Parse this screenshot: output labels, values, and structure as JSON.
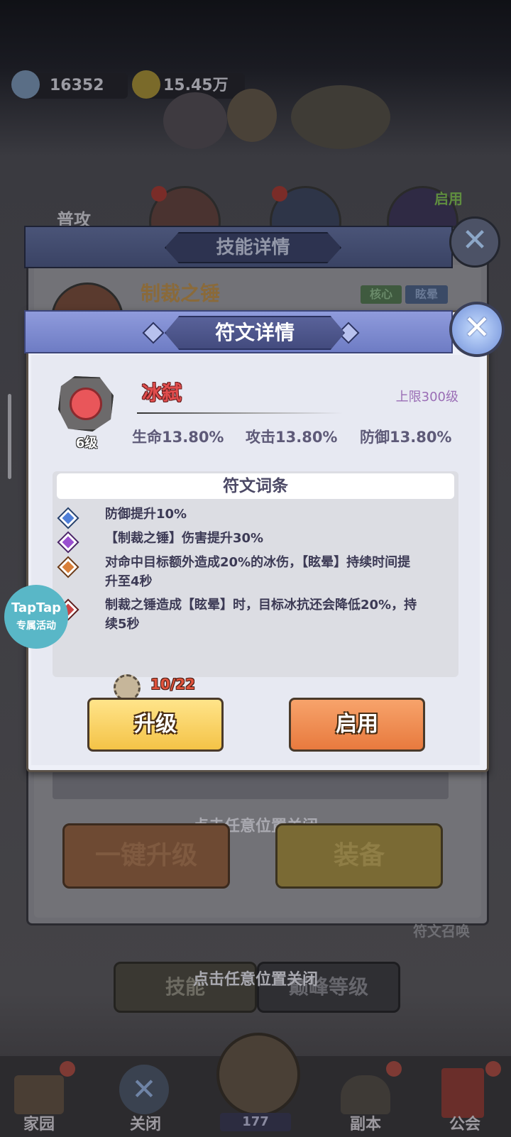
{
  "resources": {
    "gems": "16352",
    "gold": "15.45万"
  },
  "background": {
    "skill_tab_partial": "普攻",
    "enable_tag": "启用",
    "skill_name": "制裁之锤",
    "skill_tags": [
      "核心",
      "眩晕"
    ],
    "btn_upgrade_all": "一键升级",
    "btn_equip": "装备",
    "rune_summon": "符文召唤",
    "tab_skill": "技能",
    "tab_peak": "巅峰等级",
    "close_hint": "点击任意位置关闭"
  },
  "skill_panel": {
    "title": "技能详情"
  },
  "rune_panel": {
    "title": "符文详情",
    "rune_name": "冰弑",
    "level": "6级",
    "max_level": "上限300级",
    "stats": [
      "生命13.80%",
      "攻击13.80%",
      "防御13.80%"
    ],
    "entries_title": "符文词条",
    "entries": [
      {
        "text": "防御提升10%",
        "color": "#4f7fd8"
      },
      {
        "text": "【制裁之锤】伤害提升30%",
        "color": "#9a4fd0"
      },
      {
        "text": "对命中目标额外造成20%的冰伤，【眩晕】持续时间提升至4秒",
        "color": "#d9803a"
      },
      {
        "text": "制裁之锤造成【眩晕】时，目标冰抗还会降低20%，持续5秒",
        "color": "#c94545"
      }
    ],
    "material_count": "10/22",
    "btn_upgrade": "升级",
    "btn_enable": "启用"
  },
  "close_hint": "点击任意位置关闭",
  "promo_badge": {
    "line1": "TapTap",
    "line2": "专属活动"
  },
  "bottom_nav": {
    "items": [
      "家园",
      "关闭",
      "",
      "副本",
      "公会"
    ],
    "center_count": "177"
  },
  "colors": {
    "header_blue": "#7a86cf",
    "upgrade_btn": "#f4c347",
    "enable_btn": "#e87a3e",
    "rune_red": "#e14d4d"
  }
}
